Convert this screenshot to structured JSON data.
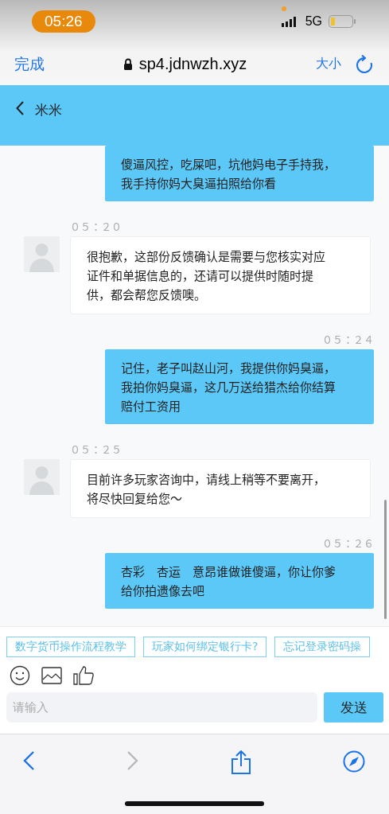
{
  "status_bar": {
    "time": "05:26",
    "network": "5G"
  },
  "browser": {
    "done": "完成",
    "url": "sp4.jdnwzh.xyz",
    "text_size": "大小"
  },
  "chat_header": {
    "title": "米米"
  },
  "messages": [
    {
      "kind": "sent",
      "text": "傻逼风控，吃屎吧，坑他妈电子手持我，我手持你妈大臭逼拍照给你看"
    },
    {
      "kind": "received",
      "time": "05:20",
      "text": "很抱歉，这部份反馈确认是需要与您核实对应证件和单据信息的，还请可以提供时随时提供，都会帮您反馈噢。"
    },
    {
      "kind": "sent",
      "time": "05:24",
      "text": "记住，老子叫赵山河，我提供你妈臭逼，我拍你妈臭逼，这几万送给猎杰给你结算赔付工资用"
    },
    {
      "kind": "received",
      "time": "05:25",
      "text": "目前许多玩家咨询中，请线上稍等不要离开，将尽快回复给您~"
    },
    {
      "kind": "sent",
      "time": "05:26",
      "text": "杏彩 杏运 意昂谁做谁傻逼，你让你爹给你拍遗像去吧"
    }
  ],
  "quick_questions": [
    "数字货币操作流程教学",
    "玩家如何绑定银行卡?",
    "忘记登录密码操"
  ],
  "composer": {
    "placeholder": "请输入",
    "send": "发送"
  }
}
